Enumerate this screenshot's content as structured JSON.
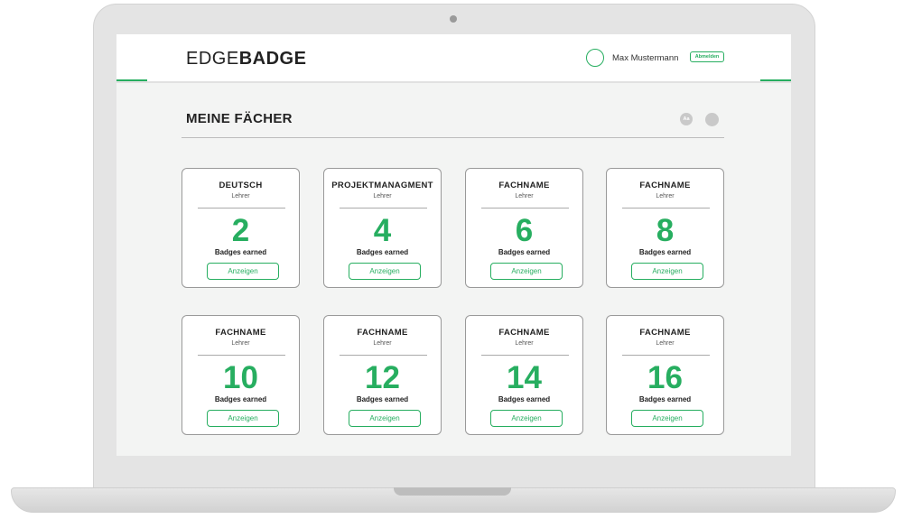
{
  "header": {
    "logo_light": "EDGE",
    "logo_bold": "BADGE",
    "user_name": "Max Mustermann",
    "logout_label": "Abmelden"
  },
  "main": {
    "title": "MEINE FÄCHER",
    "font_size_icon": "Aa"
  },
  "cards": [
    {
      "subject": "DEUTSCH",
      "role": "Lehrer",
      "count": "2",
      "caption": "Badges earned",
      "button": "Anzeigen"
    },
    {
      "subject": "PROJEKTMANAGMENT",
      "role": "Lehrer",
      "count": "4",
      "caption": "Badges earned",
      "button": "Anzeigen"
    },
    {
      "subject": "FACHNAME",
      "role": "Lehrer",
      "count": "6",
      "caption": "Badges earned",
      "button": "Anzeigen"
    },
    {
      "subject": "FACHNAME",
      "role": "Lehrer",
      "count": "8",
      "caption": "Badges earned",
      "button": "Anzeigen"
    },
    {
      "subject": "FACHNAME",
      "role": "Lehrer",
      "count": "10",
      "caption": "Badges earned",
      "button": "Anzeigen"
    },
    {
      "subject": "FACHNAME",
      "role": "Lehrer",
      "count": "12",
      "caption": "Badges earned",
      "button": "Anzeigen"
    },
    {
      "subject": "FACHNAME",
      "role": "Lehrer",
      "count": "14",
      "caption": "Badges earned",
      "button": "Anzeigen"
    },
    {
      "subject": "FACHNAME",
      "role": "Lehrer",
      "count": "16",
      "caption": "Badges earned",
      "button": "Anzeigen"
    }
  ],
  "colors": {
    "accent": "#27ae60",
    "background": "#f3f4f3",
    "card_border": "#999999"
  }
}
